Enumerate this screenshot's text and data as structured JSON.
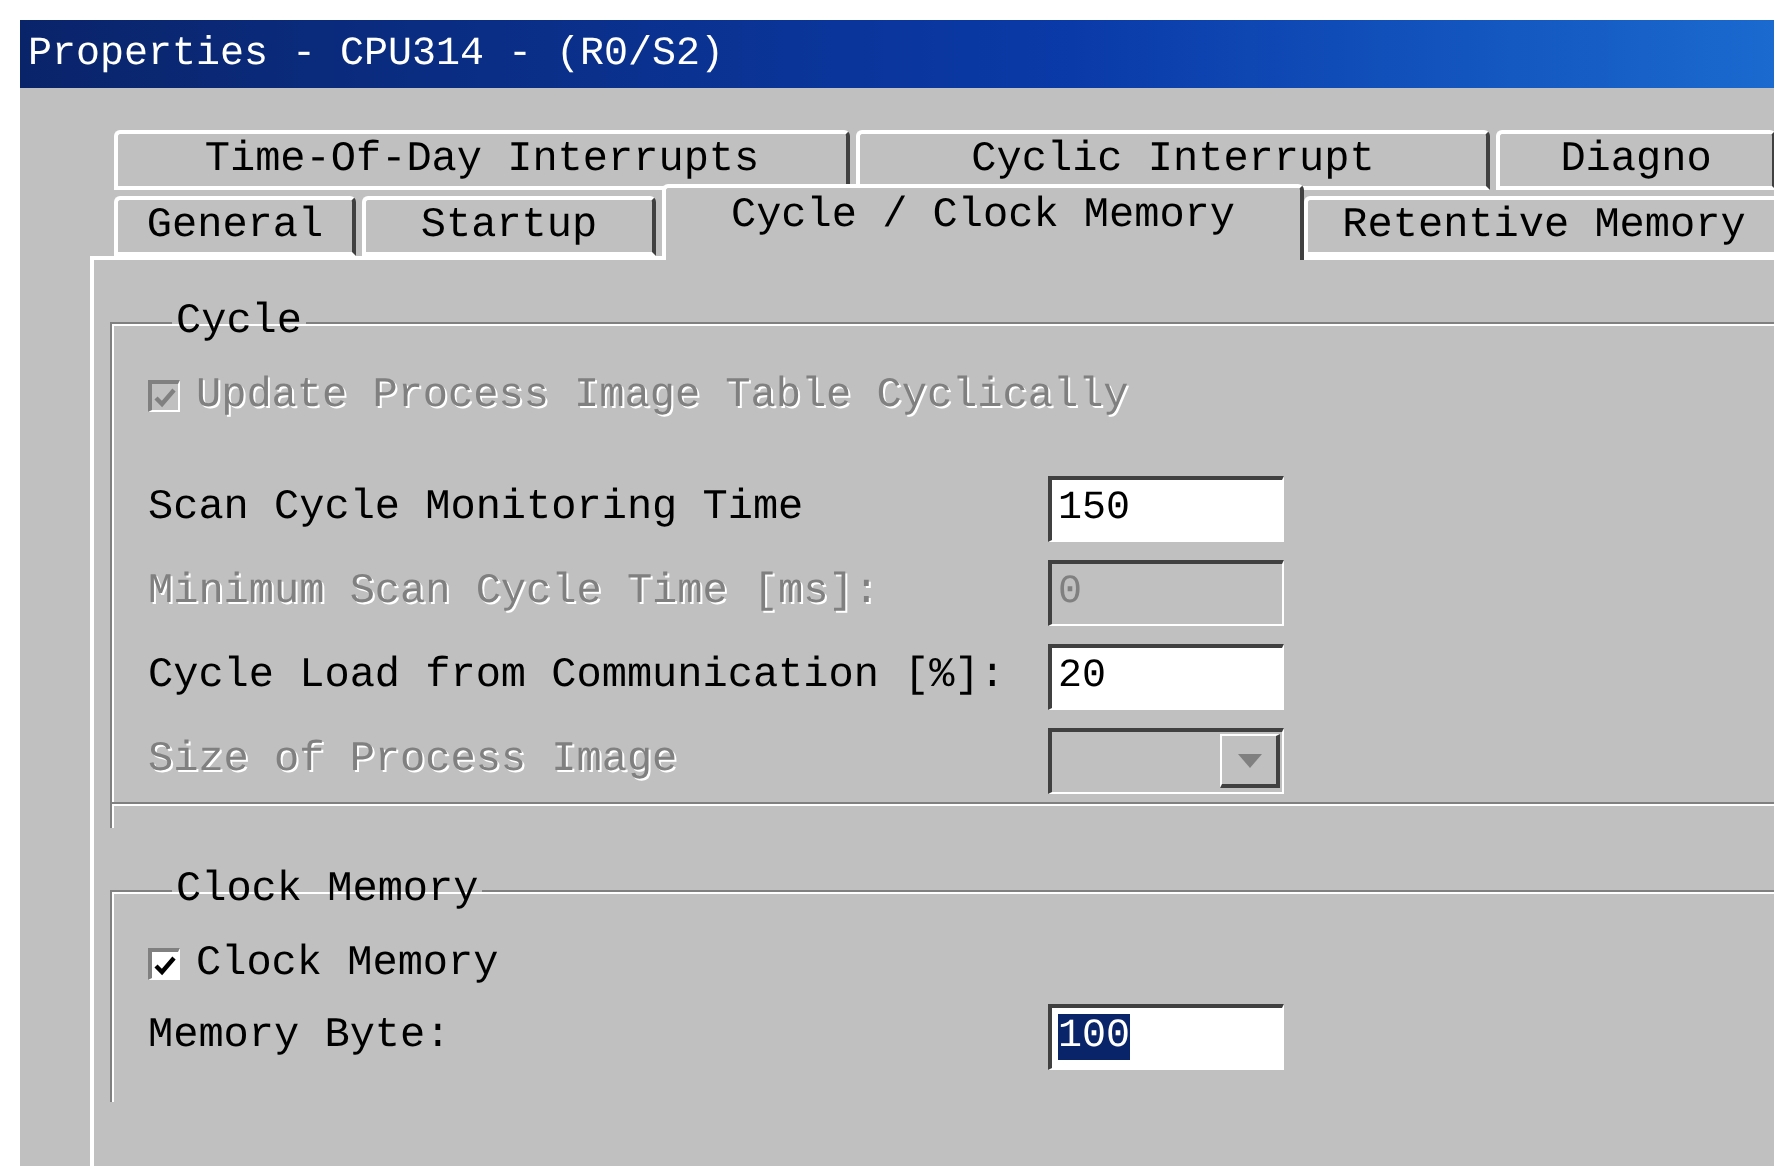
{
  "window": {
    "title": "Properties - CPU314 - (R0/S2)"
  },
  "tab_rows": [
    {
      "tabs": [
        {
          "label": "Time-Of-Day Interrupts",
          "selected": false
        },
        {
          "label": "Cyclic Interrupt",
          "selected": false
        },
        {
          "label": "Diagno",
          "selected": false
        }
      ]
    },
    {
      "tabs": [
        {
          "label": "General",
          "selected": false
        },
        {
          "label": "Startup",
          "selected": false
        },
        {
          "label": "Cycle / Clock Memory",
          "selected": true
        },
        {
          "label": "Retentive Memory",
          "selected": false
        }
      ]
    }
  ],
  "groups": [
    {
      "title": "Cycle",
      "checkbox": {
        "label": "Update Process Image Table Cyclically",
        "checked": true,
        "disabled": true
      },
      "fields": [
        {
          "kind": "text",
          "label": "Scan Cycle Monitoring Time",
          "value": "150",
          "disabled": false,
          "highlighted": false
        },
        {
          "kind": "text",
          "label": "Minimum Scan Cycle Time [ms]:",
          "value": "0",
          "disabled": true,
          "highlighted": false
        },
        {
          "kind": "text",
          "label": "Cycle Load from Communication [%]:",
          "value": "20",
          "disabled": false,
          "highlighted": false
        },
        {
          "kind": "dropdown",
          "label": "Size of Process Image",
          "disabled": true
        }
      ]
    },
    {
      "title": "Clock Memory",
      "checkbox": {
        "label": "Clock Memory",
        "checked": true,
        "disabled": false
      },
      "fields": [
        {
          "kind": "text",
          "label": "Memory Byte:",
          "value": "100",
          "disabled": false,
          "highlighted": true
        }
      ]
    }
  ]
}
